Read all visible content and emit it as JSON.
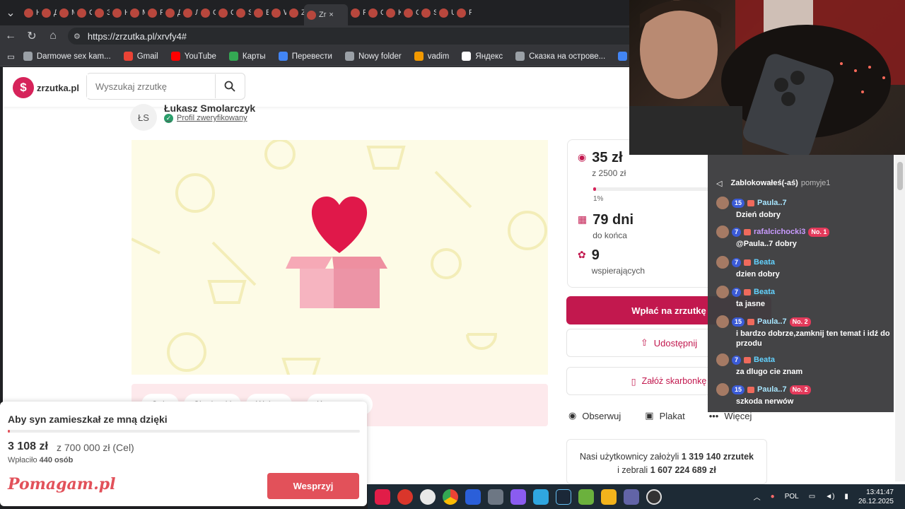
{
  "browser": {
    "tabs": [
      {
        "label": "Н"
      },
      {
        "label": "Д"
      },
      {
        "label": "М"
      },
      {
        "label": "С"
      },
      {
        "label": "З"
      },
      {
        "label": "Н"
      },
      {
        "label": "М"
      },
      {
        "label": "Р"
      },
      {
        "label": "Д"
      },
      {
        "label": "Л"
      },
      {
        "label": "С"
      },
      {
        "label": "С"
      },
      {
        "label": "S"
      },
      {
        "label": "Е"
      },
      {
        "label": "W"
      },
      {
        "label": "Z"
      },
      {
        "label": "Zr",
        "active": true
      },
      {
        "label": "Р"
      },
      {
        "label": "О"
      },
      {
        "label": "К"
      },
      {
        "label": "О"
      },
      {
        "label": "S"
      },
      {
        "label": "U"
      },
      {
        "label": "F"
      }
    ],
    "url": "https://zrzutka.pl/xrvfy4#",
    "bookmarks": [
      {
        "label": "Darmowe sex kam...",
        "color": "#9aa0a6"
      },
      {
        "label": "Gmail",
        "color": "#ea4335"
      },
      {
        "label": "YouTube",
        "color": "#ff0000"
      },
      {
        "label": "Карты",
        "color": "#34a853"
      },
      {
        "label": "Перевести",
        "color": "#4285f4"
      },
      {
        "label": "Nowy folder",
        "color": "#9aa0a6"
      },
      {
        "label": "vadim",
        "color": "#f29900"
      },
      {
        "label": "Яндекс",
        "color": "#ffffff"
      },
      {
        "label": "Сказка на острове...",
        "color": "#9aa0a6"
      },
      {
        "label": "Избранные",
        "color": "#4285f4"
      }
    ]
  },
  "site": {
    "logo_letter": "$",
    "logo_text": "zrzutka.pl",
    "search_placeholder": "Wyszukaj zrzutkę",
    "organizer": {
      "initials": "ŁS",
      "name": "Łukasz Smolarczyk",
      "verified_label": "Profil zweryfikowany",
      "verified_mark": "✓"
    },
    "campaign": {
      "raised": "35 zł",
      "goal": "z 2500 zł",
      "progress_percent": 1,
      "progress_label": "1%",
      "days": "79 dni",
      "days_label": "do końca",
      "supporters": "9",
      "supporters_label": "wspierających"
    },
    "buttons": {
      "donate": "Wpłać na zrzutkę",
      "share": "Udostępnij",
      "piggybank": "Załóż skarbonkę"
    },
    "actions": {
      "follow": "Obserwuj",
      "poster": "Plakat",
      "more": "Więcej"
    },
    "stats": {
      "line1_prefix": "Nasi użytkownicy założyli",
      "line1_value": "1 319 140 zrzutek",
      "line2_prefix": "i zebrali",
      "line2_value": "1 607 224 689 zł"
    },
    "content_tabs": [
      "Opis",
      "Skarbonki",
      "Wpłaty",
      "Komentarze"
    ]
  },
  "popup": {
    "title": "Aby syn zamieszkał ze mną dzięki",
    "amount": "3 108 zł",
    "goal": "z 700 000 zł (Cel)",
    "donated_prefix": "Wpłaciło",
    "donated_count": "440 osób",
    "logo": "Pomagam.pl",
    "button": "Wesprzyj",
    "progress_fraction": 0.004
  },
  "chat": {
    "system_message": "Zablokowałeś(-aś)",
    "system_user": "pomyje1",
    "messages": [
      {
        "level": "15",
        "user": "Paula..7",
        "text": "Dzień dobry",
        "user_color": "#a8e6ff",
        "rank": ""
      },
      {
        "level": "7",
        "user": "rafalcichocki3",
        "text": "@Paula..7 dobry",
        "user_color": "#c99bff",
        "rank": "No. 1"
      },
      {
        "level": "7",
        "user": "Beata",
        "text": "dzien dobry",
        "user_color": "#63d2ff",
        "rank": ""
      },
      {
        "level": "7",
        "user": "Beata",
        "text": "ta jasne",
        "user_color": "#63d2ff",
        "rank": ""
      },
      {
        "level": "15",
        "user": "Paula..7",
        "text": "i bardzo dobrze,zamknij ten temat i idź do przodu",
        "user_color": "#a8e6ff",
        "rank": "No. 2"
      },
      {
        "level": "7",
        "user": "Beata",
        "text": "za dlugo cie znam",
        "user_color": "#63d2ff",
        "rank": ""
      },
      {
        "level": "15",
        "user": "Paula..7",
        "text": "szkoda nerwów",
        "user_color": "#a8e6ff",
        "rank": "No. 2"
      }
    ]
  },
  "taskbar": {
    "language": "POL",
    "time": "13:41:47",
    "date": "26.12.2025"
  },
  "colors": {
    "brand": "#d6235a",
    "donate_button": "#c2184e",
    "pomagam": "#e2515a"
  }
}
